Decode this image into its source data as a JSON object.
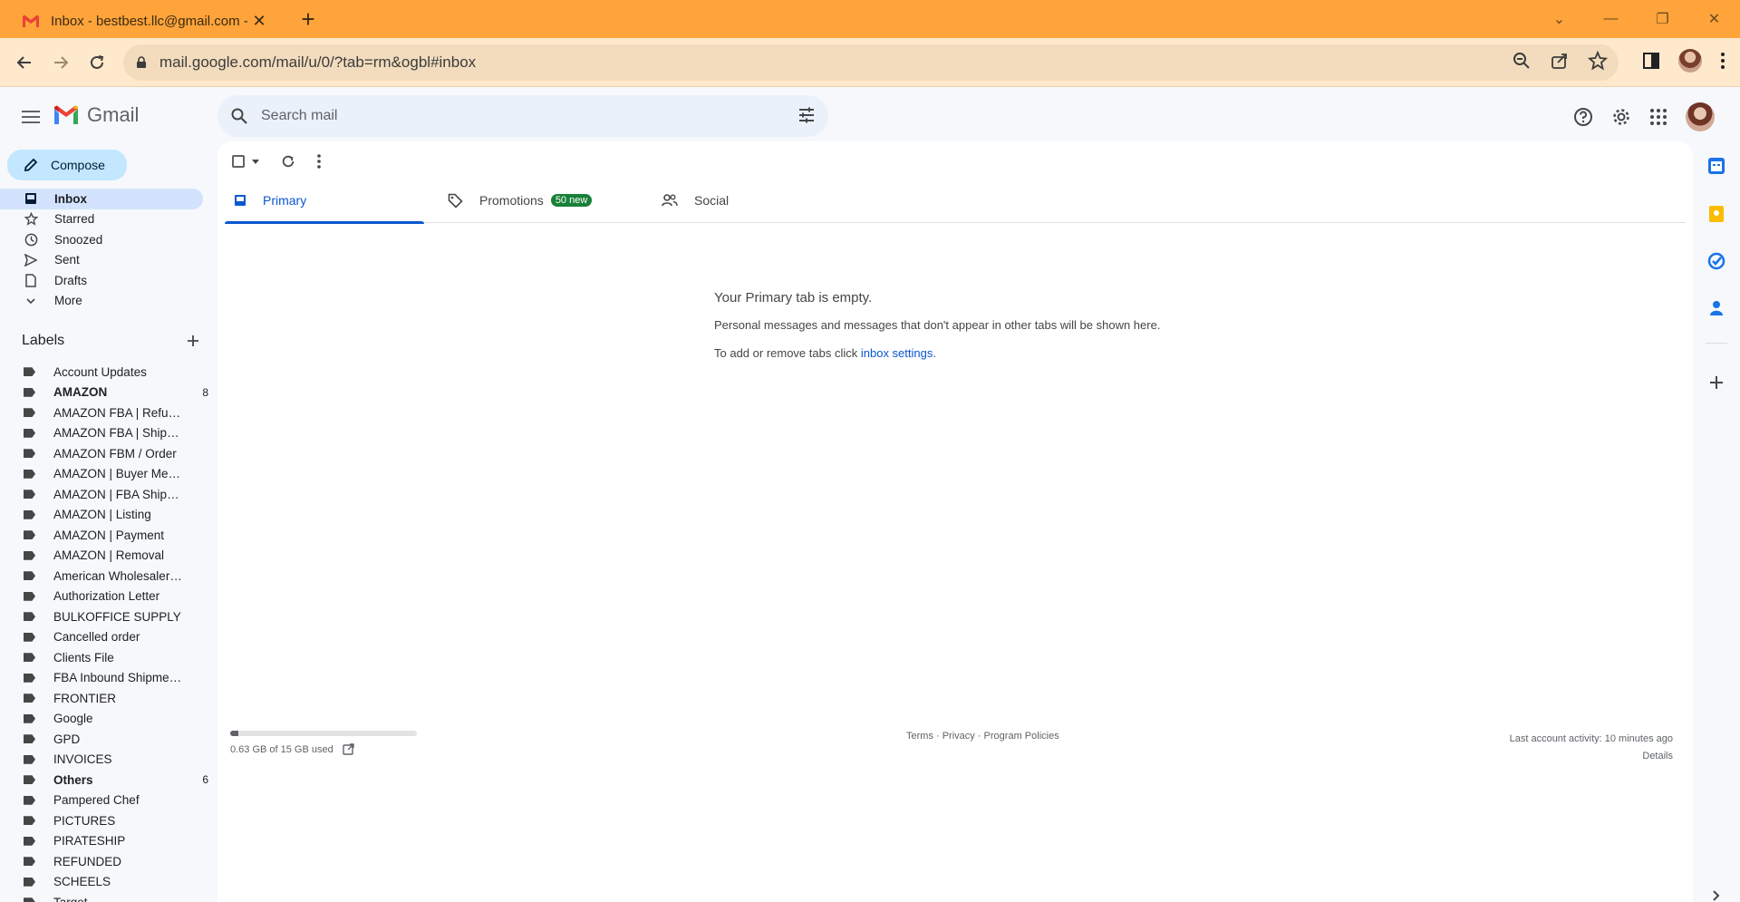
{
  "browser": {
    "tab_title": "Inbox - bestbest.llc@gmail.com -",
    "url": "mail.google.com/mail/u/0/?tab=rm&ogbl#inbox"
  },
  "gmail": {
    "brand": "Gmail",
    "search_placeholder": "Search mail"
  },
  "sidebar": {
    "compose_label": "Compose",
    "nav": [
      {
        "label": "Inbox",
        "icon": "inbox-icon"
      },
      {
        "label": "Starred",
        "icon": "star-icon"
      },
      {
        "label": "Snoozed",
        "icon": "clock-icon"
      },
      {
        "label": "Sent",
        "icon": "send-icon"
      },
      {
        "label": "Drafts",
        "icon": "draft-icon"
      },
      {
        "label": "More",
        "icon": "chevron-down-icon"
      }
    ],
    "labels_title": "Labels",
    "labels": [
      {
        "name": "Account Updates",
        "count": ""
      },
      {
        "name": "AMAZON",
        "count": "8"
      },
      {
        "name": "AMAZON FBA | Refunded",
        "count": ""
      },
      {
        "name": "AMAZON FBA | Shipped ...",
        "count": ""
      },
      {
        "name": "AMAZON FBM / Order",
        "count": ""
      },
      {
        "name": "AMAZON | Buyer Messa...",
        "count": ""
      },
      {
        "name": "AMAZON | FBA Shipments",
        "count": ""
      },
      {
        "name": "AMAZON | Listing",
        "count": ""
      },
      {
        "name": "AMAZON | Payment",
        "count": ""
      },
      {
        "name": "AMAZON | Removal",
        "count": ""
      },
      {
        "name": "American Wholesalers L...",
        "count": ""
      },
      {
        "name": "Authorization Letter",
        "count": ""
      },
      {
        "name": "BULKOFFICE SUPPLY",
        "count": ""
      },
      {
        "name": "Cancelled order",
        "count": ""
      },
      {
        "name": "Clients File",
        "count": ""
      },
      {
        "name": "FBA Inbound Shipment R...",
        "count": ""
      },
      {
        "name": "FRONTIER",
        "count": ""
      },
      {
        "name": "Google",
        "count": ""
      },
      {
        "name": "GPD",
        "count": ""
      },
      {
        "name": "INVOICES",
        "count": ""
      },
      {
        "name": "Others",
        "count": "6"
      },
      {
        "name": "Pampered Chef",
        "count": ""
      },
      {
        "name": "PICTURES",
        "count": ""
      },
      {
        "name": "PIRATESHIP",
        "count": ""
      },
      {
        "name": "REFUNDED",
        "count": ""
      },
      {
        "name": "SCHEELS",
        "count": ""
      },
      {
        "name": "Target",
        "count": ""
      }
    ]
  },
  "main": {
    "tabs": [
      {
        "label": "Primary",
        "badge": ""
      },
      {
        "label": "Promotions",
        "badge": "50 new"
      },
      {
        "label": "Social",
        "badge": ""
      }
    ],
    "empty_title": "Your Primary tab is empty.",
    "empty_desc": "Personal messages and messages that don't appear in other tabs will be shown here.",
    "empty_settings_prefix": "To add or remove tabs click ",
    "empty_settings_link": "inbox settings",
    "empty_settings_suffix": "."
  },
  "footer": {
    "storage_text": "0.63 GB of 15 GB used",
    "storage_fraction": 0.042,
    "legal": "Terms · Privacy · Program Policies",
    "last_activity": "Last account activity: 10 minutes ago",
    "details": "Details"
  },
  "colors": {
    "chrome_orange": "#ffa43b",
    "compose_blue": "#c2e7ff",
    "active_nav": "#d3e3fd",
    "link_blue": "#0b57d0",
    "badge_green": "#188038"
  }
}
